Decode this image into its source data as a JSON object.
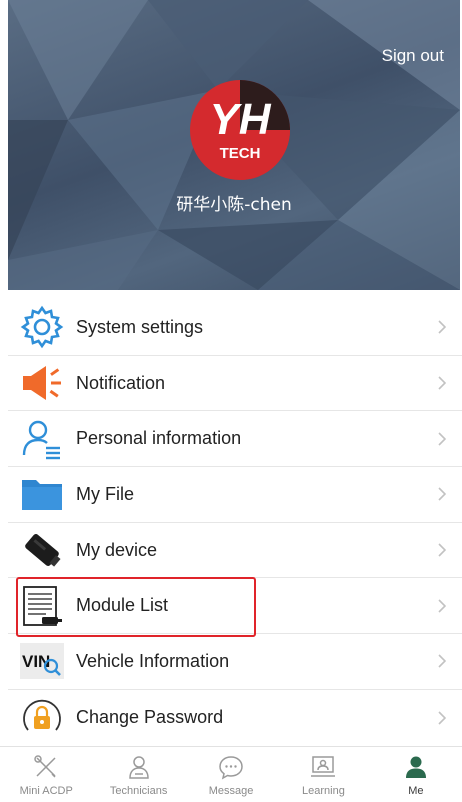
{
  "header": {
    "sign_out": "Sign out",
    "username": "研华小陈-chen",
    "logo_text": "YH",
    "logo_subtext": "TECH"
  },
  "menu": {
    "items": [
      {
        "label": "System settings",
        "icon": "gear-icon"
      },
      {
        "label": "Notification",
        "icon": "megaphone-icon"
      },
      {
        "label": "Personal information",
        "icon": "person-icon"
      },
      {
        "label": "My File",
        "icon": "folder-icon"
      },
      {
        "label": "My device",
        "icon": "device-icon"
      },
      {
        "label": "Module List",
        "icon": "module-list-icon",
        "highlighted": true
      },
      {
        "label": "Vehicle Information",
        "icon": "vin-search-icon",
        "icon_text": "VIN"
      },
      {
        "label": "Change Password",
        "icon": "lock-icon"
      }
    ]
  },
  "tabbar": {
    "tabs": [
      {
        "label": "Mini ACDP",
        "icon": "tools-icon"
      },
      {
        "label": "Technicians",
        "icon": "technician-icon"
      },
      {
        "label": "Message",
        "icon": "chat-icon"
      },
      {
        "label": "Learning",
        "icon": "learning-icon"
      },
      {
        "label": "Me",
        "icon": "me-icon",
        "active": true
      }
    ]
  },
  "colors": {
    "accent_blue": "#2f8fd8",
    "orange": "#f06a2a",
    "highlight_red": "#e0242a",
    "logo_red": "#d42a2e"
  }
}
